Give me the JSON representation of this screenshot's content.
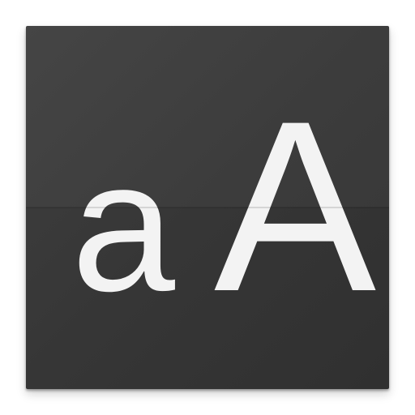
{
  "icon": {
    "name": "font-size-icon",
    "lowercase_letter": "a",
    "uppercase_letter": "A",
    "background_color": "#363636",
    "glyph_color": "#f3f3f3"
  }
}
